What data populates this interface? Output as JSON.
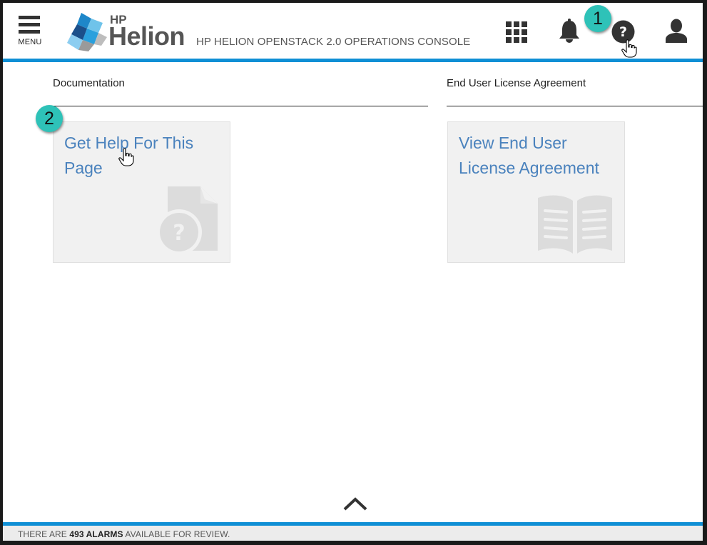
{
  "header": {
    "menu_label": "MENU",
    "logo_hp": "HP",
    "logo_helion": "Helion",
    "console_title": "HP HELION OPENSTACK 2.0 OPERATIONS CONSOLE",
    "icons": [
      "apps-grid-icon",
      "bell-icon",
      "help-icon",
      "user-icon"
    ]
  },
  "callouts": {
    "one": "1",
    "two": "2"
  },
  "documentation": {
    "title": "Documentation",
    "tile_label": "Get Help For This Page",
    "tile_icon": "help-document-icon"
  },
  "eula": {
    "title": "End User License Agreement",
    "tile_label": "View End User License Agreement",
    "tile_icon": "open-book-icon"
  },
  "footer": {
    "prefix": "THERE ARE",
    "alarm_count": "493 ALARMS",
    "suffix": "AVAILABLE FOR REVIEW."
  },
  "colors": {
    "accent_blue": "#0f8fd5",
    "link_blue": "#4a82bd",
    "callout_teal": "#2ec2b8",
    "tile_bg": "#f1f1f1"
  }
}
